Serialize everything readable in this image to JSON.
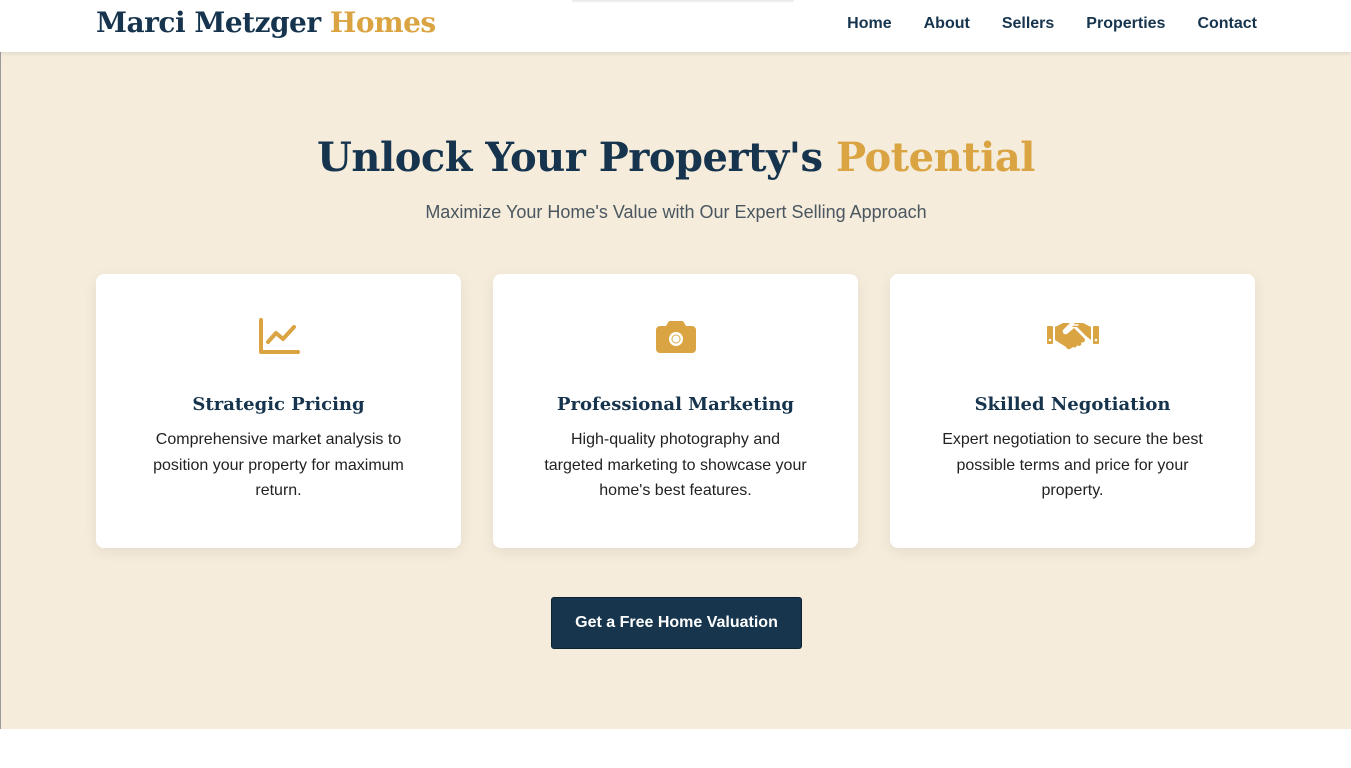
{
  "header": {
    "brand_main": "Marci Metzger",
    "brand_accent": "Homes",
    "nav": [
      "Home",
      "About",
      "Sellers",
      "Properties",
      "Contact"
    ]
  },
  "hero": {
    "title_main": "Unlock Your Property's",
    "title_accent": "Potential",
    "subtitle": "Maximize Your Home's Value with Our Expert Selling Approach",
    "cta_label": "Get a Free Home Valuation"
  },
  "cards": [
    {
      "icon": "chart-line-icon",
      "title": "Strategic Pricing",
      "text": "Comprehensive market analysis to position your property for maximum return."
    },
    {
      "icon": "camera-icon",
      "title": "Professional Marketing",
      "text": "High-quality photography and targeted marketing to showcase your home's best features."
    },
    {
      "icon": "handshake-icon",
      "title": "Skilled Negotiation",
      "text": "Expert negotiation to secure the best possible terms and price for your property."
    }
  ],
  "colors": {
    "navy": "#16344d",
    "gold": "#d9a441",
    "hero_bg": "#f5ecdc"
  }
}
